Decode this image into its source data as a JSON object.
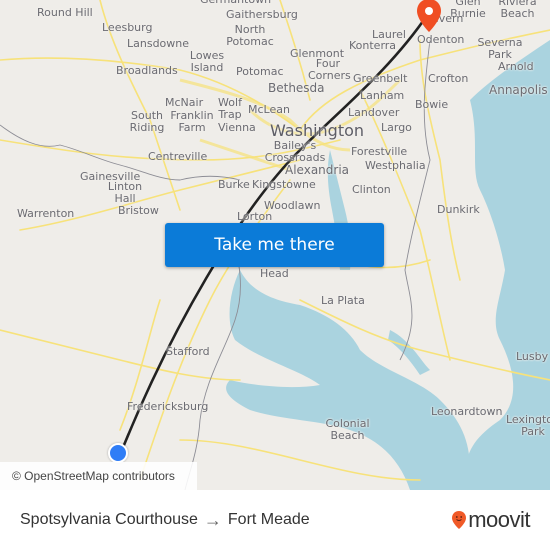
{
  "map": {
    "places": [
      {
        "name": "Round Hill",
        "size": "normal"
      },
      {
        "name": "Leesburg",
        "size": "normal"
      },
      {
        "name": "Lansdowne",
        "size": "normal"
      },
      {
        "name": "Broadlands",
        "size": "normal"
      },
      {
        "name": "Lowes Island",
        "size": "normal"
      },
      {
        "name": "McNair",
        "size": "normal"
      },
      {
        "name": "South Riding",
        "size": "normal"
      },
      {
        "name": "Franklin Farm",
        "size": "normal"
      },
      {
        "name": "Wolf Trap",
        "size": "normal"
      },
      {
        "name": "Vienna",
        "size": "normal"
      },
      {
        "name": "McLean",
        "size": "normal"
      },
      {
        "name": "Potomac",
        "size": "normal"
      },
      {
        "name": "North Potomac",
        "size": "normal"
      },
      {
        "name": "Germantown",
        "size": "normal"
      },
      {
        "name": "Gaithersburg",
        "size": "normal"
      },
      {
        "name": "Glenmont",
        "size": "normal"
      },
      {
        "name": "Four Corners",
        "size": "normal"
      },
      {
        "name": "Bethesda",
        "size": "mid"
      },
      {
        "name": "Washington",
        "size": "big"
      },
      {
        "name": "Laurel",
        "size": "normal"
      },
      {
        "name": "Konterra",
        "size": "normal"
      },
      {
        "name": "Greenbelt",
        "size": "normal"
      },
      {
        "name": "Lanham",
        "size": "normal"
      },
      {
        "name": "Landover",
        "size": "normal"
      },
      {
        "name": "Largo",
        "size": "normal"
      },
      {
        "name": "Bowie",
        "size": "normal"
      },
      {
        "name": "Crofton",
        "size": "normal"
      },
      {
        "name": "Glen Burnie",
        "size": "normal"
      },
      {
        "name": "Severn",
        "size": "normal"
      },
      {
        "name": "Odenton",
        "size": "normal"
      },
      {
        "name": "Riviera Beach",
        "size": "normal"
      },
      {
        "name": "Severna Park",
        "size": "normal"
      },
      {
        "name": "Arnold",
        "size": "normal"
      },
      {
        "name": "Annapolis",
        "size": "mid"
      },
      {
        "name": "Centreville",
        "size": "normal"
      },
      {
        "name": "Gainesville",
        "size": "normal"
      },
      {
        "name": "Linton Hall",
        "size": "normal"
      },
      {
        "name": "Bristow",
        "size": "normal"
      },
      {
        "name": "Warrenton",
        "size": "normal"
      },
      {
        "name": "Bailey's Crossroads",
        "size": "normal"
      },
      {
        "name": "Alexandria",
        "size": "mid"
      },
      {
        "name": "Burke",
        "size": "normal"
      },
      {
        "name": "Kingstowne",
        "size": "normal"
      },
      {
        "name": "Woodlawn",
        "size": "normal"
      },
      {
        "name": "Lorton",
        "size": "normal"
      },
      {
        "name": "Forestville",
        "size": "normal"
      },
      {
        "name": "Westphalia",
        "size": "normal"
      },
      {
        "name": "Clinton",
        "size": "normal"
      },
      {
        "name": "Dunkirk",
        "size": "normal"
      },
      {
        "name": "Head",
        "size": "normal"
      },
      {
        "name": "La Plata",
        "size": "normal"
      },
      {
        "name": "Stafford",
        "size": "normal"
      },
      {
        "name": "Fredericksburg",
        "size": "normal"
      },
      {
        "name": "Colonial Beach",
        "size": "normal"
      },
      {
        "name": "Leonardtown",
        "size": "normal"
      },
      {
        "name": "Lexington Park",
        "size": "normal"
      },
      {
        "name": "Lusby",
        "size": "normal"
      }
    ],
    "origin_marker": {
      "label": "Spotsylvania Courthouse",
      "color": "#2f7df6",
      "icon": "origin-dot-icon"
    },
    "destination_marker": {
      "label": "Fort Meade",
      "color": "#f04e23",
      "icon": "map-pin-icon"
    },
    "route_line_color": "#222222",
    "attribution": "© OpenStreetMap contributors"
  },
  "cta": {
    "label": "Take me there",
    "color": "#0b7bd8"
  },
  "footer": {
    "origin": "Spotsylvania Courthouse",
    "arrow": "→",
    "destination": "Fort Meade",
    "brand": "moovit",
    "brand_icon": "moovit-pin-icon",
    "brand_color": "#f05a28"
  }
}
